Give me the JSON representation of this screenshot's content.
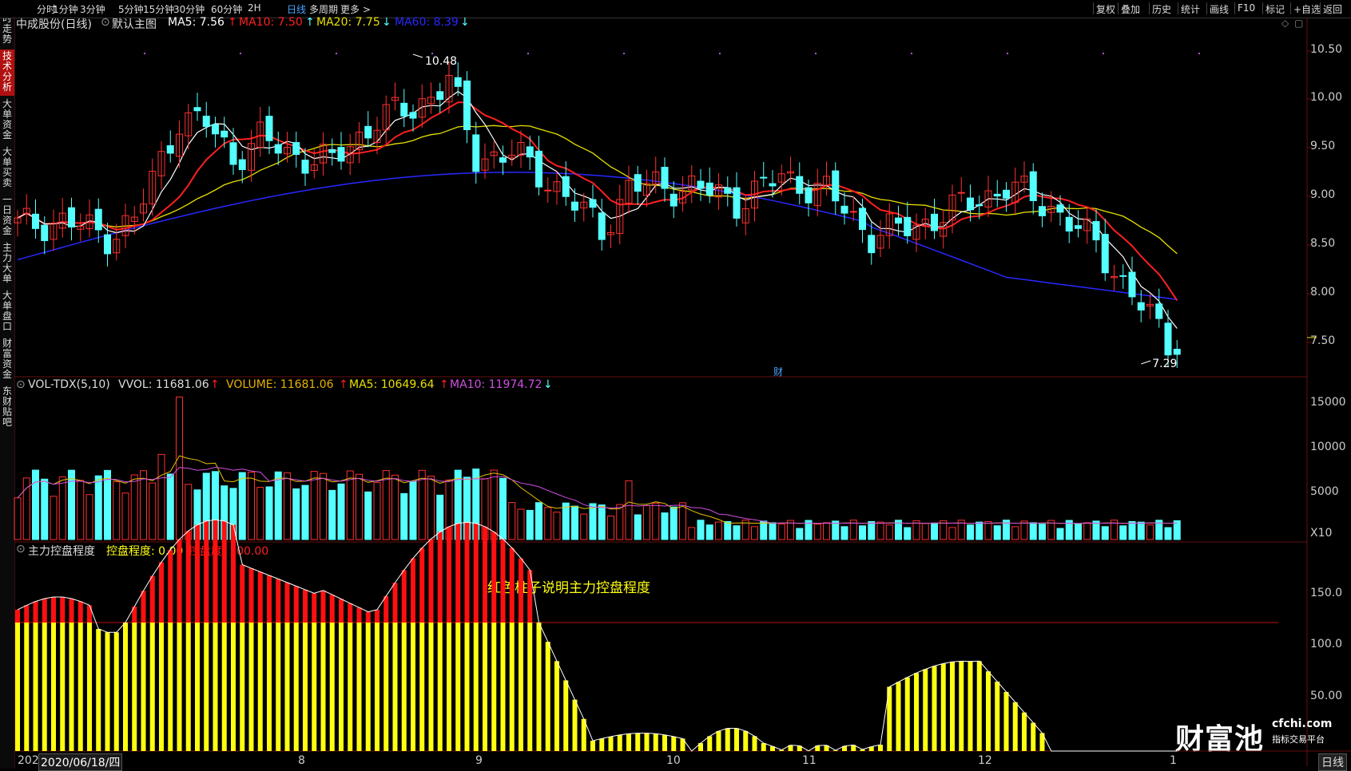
{
  "toolbar": {
    "left": [
      "分时",
      "1分钟",
      "3分钟",
      "5分钟",
      "15分钟",
      "30分钟",
      "60分钟",
      "2H",
      "日线",
      "多周期",
      "更多 >"
    ],
    "active": "日线",
    "right": [
      "复权",
      "叠加",
      "历史",
      "统计",
      "画线",
      "F10",
      "标记",
      "+自选",
      "返回"
    ]
  },
  "sidebar": {
    "tabs": [
      "分时走势",
      "技术分析",
      "大单资金",
      "大单买卖",
      "一日资金",
      "主力大单",
      "大单盘口",
      "财富资金",
      "东财贴吧"
    ],
    "active": "技术分析"
  },
  "header": {
    "stock": "中成股份(日线)",
    "main_chart": "默认主图",
    "ma5": "MA5: 7.56",
    "ma10": "MA10: 7.50",
    "ma20": "MA20: 7.75",
    "ma60": "MA60: 8.39",
    "ma5_arrow": "↑",
    "ma10_arrow": "↑",
    "ma20_arrow": "↓",
    "ma60_arrow": "↓"
  },
  "vol_header": {
    "name": "VOL-TDX(5,10)",
    "vvol": "VVOL: 11681.06",
    "volume": "VOLUME: 11681.06",
    "ma5": "MA5: 10649.64",
    "ma10": "MA10: 11974.72",
    "vvol_arrow": "↑",
    "volume_arrow": "↑",
    "ma5_arrow": "↑",
    "ma10_arrow": "↓"
  },
  "ctrl_header": {
    "name": "主力控盘程度",
    "kp": "控盘程度: 0.00",
    "kpd": "控盘度: 100.00"
  },
  "annotation": "红色柱子说明主力控盘程度",
  "price_max_label": "10.48",
  "price_min_label": "7.29",
  "cai_marker": "财",
  "price_axis": [
    "10.50",
    "10.00",
    "9.50",
    "9.00",
    "8.50",
    "8.00",
    "7.50"
  ],
  "vol_axis": [
    "15000",
    "10000",
    "5000"
  ],
  "vol_unit": "X10",
  "ctrl_axis": [
    "150.0",
    "100.0",
    "50.00"
  ],
  "date_axis": {
    "first": "202",
    "cursor_date": "2020/06/18/四",
    "months": [
      "8",
      "9",
      "10",
      "11",
      "12",
      "1"
    ],
    "period": "日线"
  },
  "watermark": {
    "brand": "财富池",
    "site": "cfchi.com",
    "slogan": "指标交易平台"
  },
  "colors": {
    "up": "#ff3030",
    "down": "#54ffff",
    "ma5": "#ffffff",
    "ma10": "#ff2020",
    "ma20": "#e8e000",
    "ma60": "#2828ff",
    "vol_ma10": "#d050e0",
    "ctrl_red": "#ff1010",
    "ctrl_yellow": "#ffff10"
  }
}
